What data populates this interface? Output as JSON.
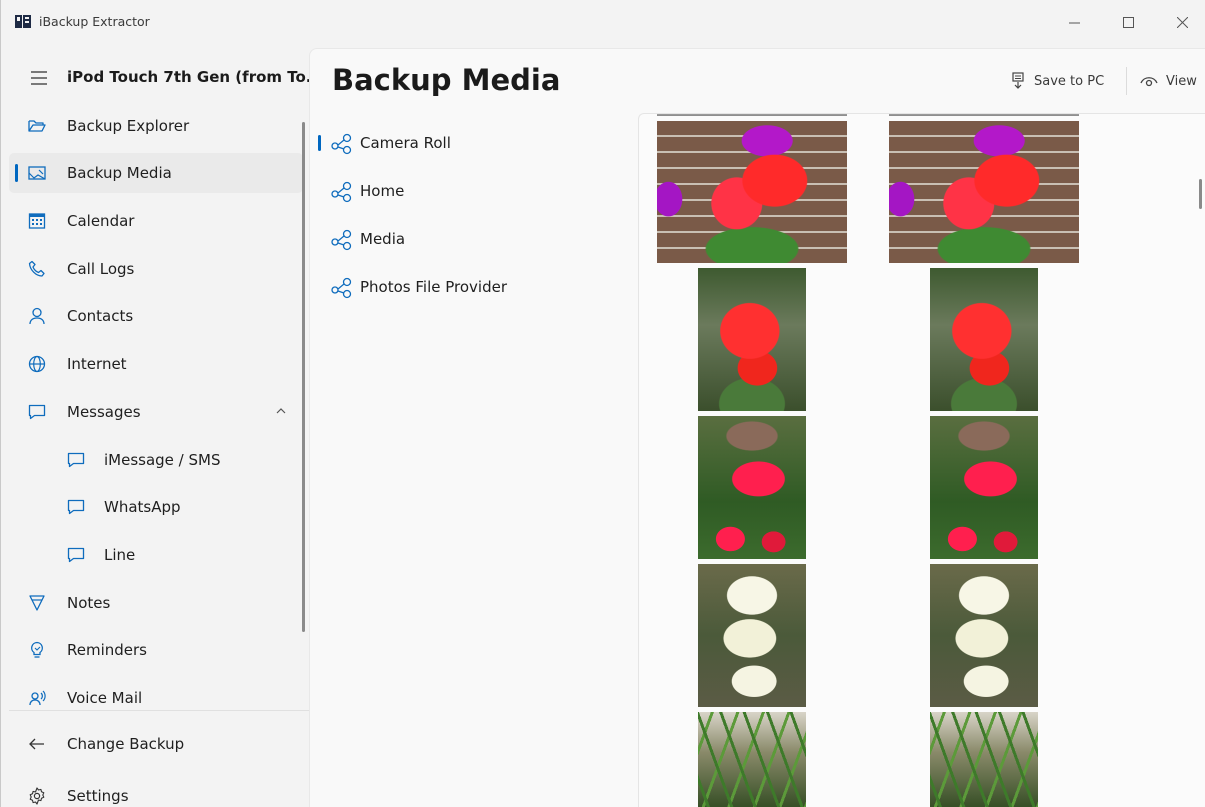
{
  "window": {
    "app_title": "iBackup Extractor",
    "icons": {
      "app": "ibackup-app-icon",
      "minimize": "minimize-icon",
      "maximize": "maximize-icon",
      "close": "close-icon"
    }
  },
  "sidebar": {
    "device_title": "iPod Touch 7th Gen (from To...",
    "items": [
      {
        "label": "Backup Explorer",
        "icon": "folder-open-icon"
      },
      {
        "label": "Backup Media",
        "icon": "image-icon",
        "selected": true
      },
      {
        "label": "Calendar",
        "icon": "calendar-icon"
      },
      {
        "label": "Call Logs",
        "icon": "phone-icon"
      },
      {
        "label": "Contacts",
        "icon": "person-icon"
      },
      {
        "label": "Internet",
        "icon": "globe-icon"
      },
      {
        "label": "Messages",
        "icon": "chat-icon",
        "expanded": true
      },
      {
        "label": "iMessage / SMS",
        "icon": "chat-icon",
        "sub": true
      },
      {
        "label": "WhatsApp",
        "icon": "chat-icon",
        "sub": true
      },
      {
        "label": "Line",
        "icon": "chat-icon",
        "sub": true
      },
      {
        "label": "Notes",
        "icon": "notes-icon"
      },
      {
        "label": "Reminders",
        "icon": "lightbulb-icon"
      },
      {
        "label": "Voice Mail",
        "icon": "voicemail-icon"
      }
    ],
    "footer": [
      {
        "label": "Change Backup",
        "icon": "arrow-left-icon"
      },
      {
        "label": "Settings",
        "icon": "gear-icon"
      }
    ]
  },
  "main": {
    "page_title": "Backup Media",
    "toolbar": {
      "save_label": "Save to PC",
      "view_label": "View"
    },
    "albums": [
      {
        "label": "Camera Roll",
        "selected": true
      },
      {
        "label": "Home"
      },
      {
        "label": "Media"
      },
      {
        "label": "Photos File Provider"
      }
    ]
  },
  "colors": {
    "accent": "#0067c0",
    "background": "#f3f3f3",
    "panel": "#f9f9f9"
  }
}
